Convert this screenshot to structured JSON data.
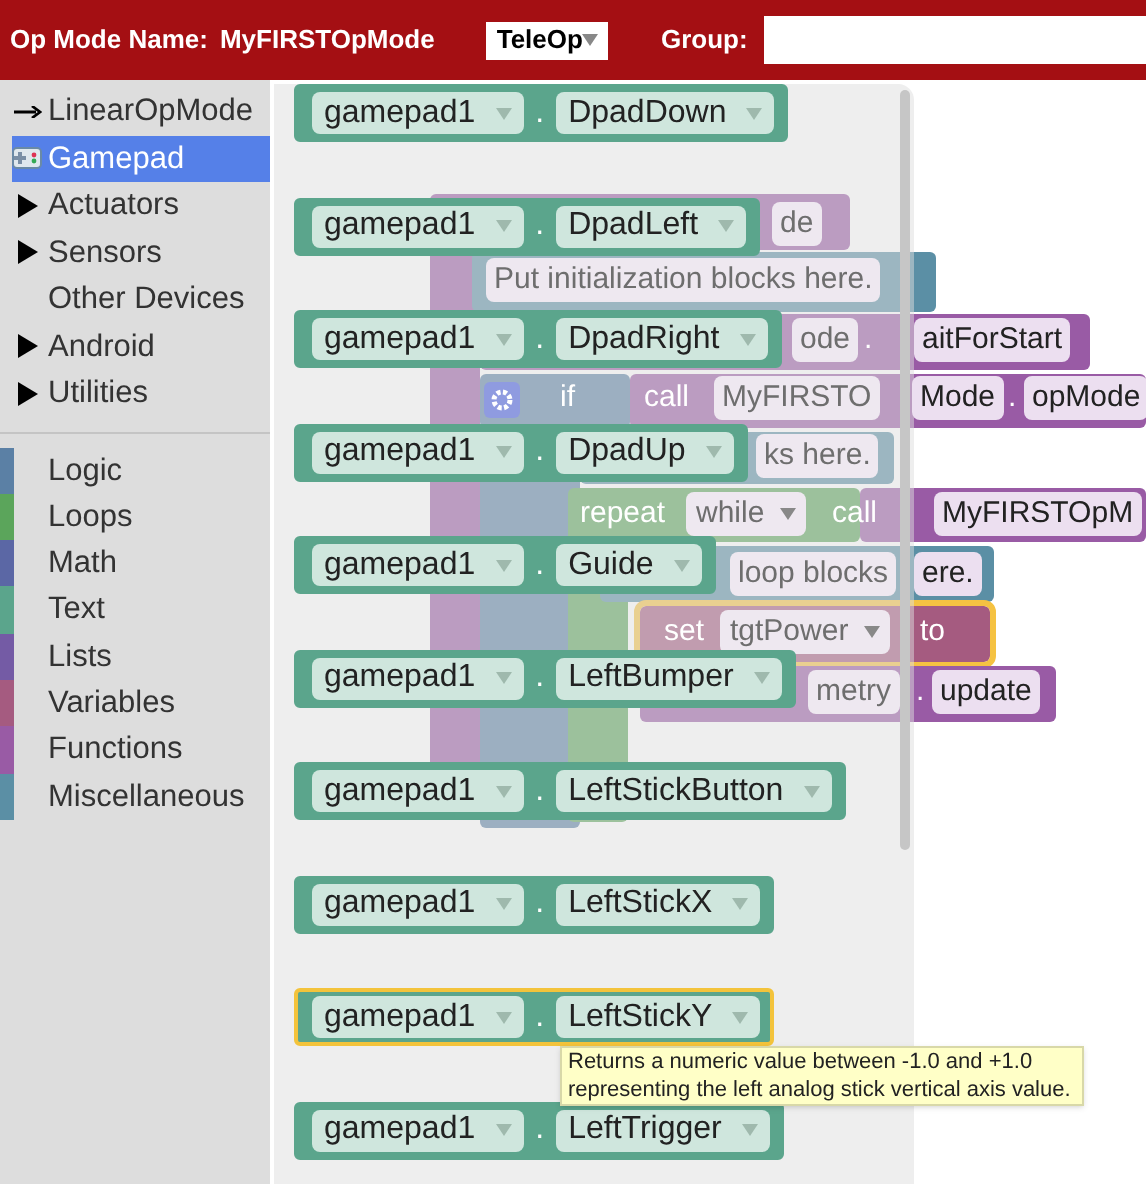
{
  "header": {
    "name_label": "Op Mode Name:",
    "name": "MyFIRSTOpMode",
    "mode": "TeleOp",
    "group_label": "Group:"
  },
  "toolbox": {
    "items": [
      {
        "label": "LinearOpMode",
        "kind": "linear",
        "selected": false
      },
      {
        "label": "Gamepad",
        "kind": "gamepad",
        "selected": true
      },
      {
        "label": "Actuators",
        "kind": "folder",
        "selected": false
      },
      {
        "label": "Sensors",
        "kind": "folder",
        "selected": false
      },
      {
        "label": "Other Devices",
        "kind": "leaf",
        "selected": false
      },
      {
        "label": "Android",
        "kind": "folder",
        "selected": false
      },
      {
        "label": "Utilities",
        "kind": "folder",
        "selected": false
      }
    ],
    "categories": [
      {
        "label": "Logic",
        "color": "#5b80a5",
        "selected": false
      },
      {
        "label": "Loops",
        "color": "#5ba55b",
        "selected": false
      },
      {
        "label": "Math",
        "color": "#5b67a5",
        "selected": false
      },
      {
        "label": "Text",
        "color": "#5ba58c",
        "selected": false
      },
      {
        "label": "Lists",
        "color": "#745ba5",
        "selected": false
      },
      {
        "label": "Variables",
        "color": "#a55b80",
        "selected": false
      },
      {
        "label": "Functions",
        "color": "#995ba5",
        "selected": false
      },
      {
        "label": "Miscellaneous",
        "color": "#5b8fa5",
        "selected": false
      }
    ]
  },
  "workspace": {
    "fragments": [
      {
        "text": "de",
        "kind": "chip"
      },
      {
        "text": "Put initialization blocks here.",
        "kind": "chip"
      },
      {
        "text": "ode",
        "kind": "chip"
      },
      {
        "text": ".",
        "kind": "label"
      },
      {
        "text": "aitForStart",
        "kind": "chip"
      },
      {
        "text": "if",
        "kind": "label"
      },
      {
        "text": "call",
        "kind": "label"
      },
      {
        "text": "MyFIRSTO",
        "kind": "chip"
      },
      {
        "text": "Mode",
        "kind": "chip"
      },
      {
        "text": ".",
        "kind": "label"
      },
      {
        "text": "opMode",
        "kind": "chip"
      },
      {
        "text": "ks here.",
        "kind": "chip"
      },
      {
        "text": "repeat",
        "kind": "label"
      },
      {
        "text": "while",
        "kind": "dropdown"
      },
      {
        "text": "call",
        "kind": "label"
      },
      {
        "text": "MyFIRSTOpM",
        "kind": "chip"
      },
      {
        "text": "loop blocks",
        "kind": "chip"
      },
      {
        "text": "ere.",
        "kind": "chip"
      },
      {
        "text": "set",
        "kind": "label"
      },
      {
        "text": "tgtPower",
        "kind": "dropdown"
      },
      {
        "text": "to",
        "kind": "label"
      },
      {
        "text": "metry",
        "kind": "chip"
      },
      {
        "text": ".",
        "kind": "label"
      },
      {
        "text": "update",
        "kind": "chip"
      }
    ]
  },
  "flyout": {
    "blocks": [
      {
        "object": "gamepad1",
        "separator": ".",
        "property": "DpadDown",
        "selected": false
      },
      {
        "object": "gamepad1",
        "separator": ".",
        "property": "DpadLeft",
        "selected": false
      },
      {
        "object": "gamepad1",
        "separator": ".",
        "property": "DpadRight",
        "selected": false
      },
      {
        "object": "gamepad1",
        "separator": ".",
        "property": "DpadUp",
        "selected": false
      },
      {
        "object": "gamepad1",
        "separator": ".",
        "property": "Guide",
        "selected": false
      },
      {
        "object": "gamepad1",
        "separator": ".",
        "property": "LeftBumper",
        "selected": false
      },
      {
        "object": "gamepad1",
        "separator": ".",
        "property": "LeftStickButton",
        "selected": false
      },
      {
        "object": "gamepad1",
        "separator": ".",
        "property": "LeftStickX",
        "selected": false
      },
      {
        "object": "gamepad1",
        "separator": ".",
        "property": "LeftStickY",
        "selected": true
      },
      {
        "object": "gamepad1",
        "separator": ".",
        "property": "LeftTrigger",
        "selected": false
      }
    ]
  },
  "tooltip": "Returns a numeric value between -1.0 and +1.0 representing the left analog stick vertical axis value."
}
